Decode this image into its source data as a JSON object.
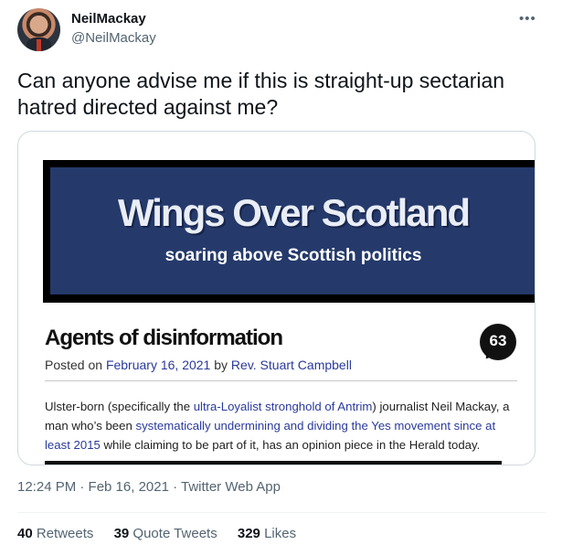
{
  "author": {
    "display_name": "NeilMackay",
    "handle": "@NeilMackay",
    "more_icon": "•••"
  },
  "tweet": {
    "text": "Can anyone advise me if this is straight-up sectarian hatred directed against me?"
  },
  "card": {
    "banner_title": "Wings Over Scotland",
    "banner_subtitle": "soaring above Scottish politics",
    "banner_bg_color": "#253a6b",
    "post_title": "Agents of disinformation",
    "comment_count": "63",
    "meta_prefix": "Posted on ",
    "meta_date": "February 16, 2021",
    "meta_by": " by ",
    "meta_author": "Rev. Stuart Campbell",
    "link_color": "#2a3a9c",
    "body": {
      "p1": "Ulster-born (specifically the ",
      "link1": "ultra-Loyalist stronghold of Antrim",
      "p2": ") journalist Neil Mackay, a man who’s been ",
      "link2": "systematically undermining and dividing the Yes movement since at least 2015",
      "p3": " while claiming to be part of it, has an opinion piece in the Herald today."
    }
  },
  "footer": {
    "time": "12:24 PM · Feb 16, 2021 · ",
    "app": "Twitter Web App"
  },
  "stats": {
    "retweets_count": "40",
    "retweets_label": "Retweets",
    "quotes_count": "39",
    "quotes_label": "Quote Tweets",
    "likes_count": "329",
    "likes_label": "Likes"
  }
}
